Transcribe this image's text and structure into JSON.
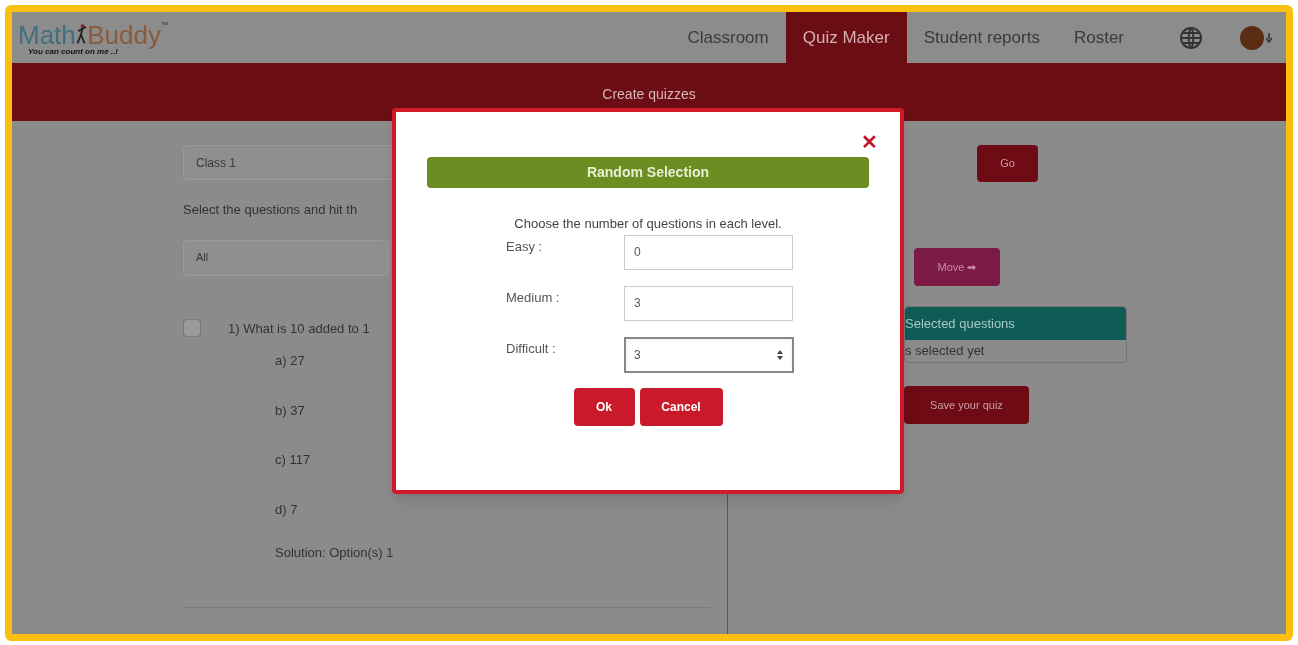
{
  "logo": {
    "word_1": "Math",
    "word_2": "Buddy",
    "trademark": "™",
    "tagline": "You can count on me ..!"
  },
  "nav": [
    {
      "label": "Classroom",
      "selected": false
    },
    {
      "label": "Quiz Maker",
      "selected": true
    },
    {
      "label": "Student reports",
      "selected": false
    },
    {
      "label": "Roster",
      "selected": false
    }
  ],
  "banner": {
    "title": "Create quizzes"
  },
  "left": {
    "class_select": {
      "value": "Class 1"
    },
    "instruction": "Select the questions and hit th",
    "filter_select": {
      "value": "All"
    },
    "question": {
      "checked": false,
      "text": "1) What is 10 added to 1",
      "options": [
        "a) 27",
        "b) 37",
        "c) 117",
        "d) 7"
      ],
      "solution": "Solution: Option(s) 1"
    }
  },
  "right": {
    "go_button": "Go",
    "move_button": "Move ➡",
    "selected_panel": {
      "title": "Selected questions",
      "empty_text": "s selected yet"
    },
    "save_button": "Save your quiz"
  },
  "dialog": {
    "close": "✕",
    "title": "Random Selection",
    "instruction": "Choose the number of questions in each level.",
    "fields": [
      {
        "label": "Easy :",
        "value": "0",
        "focused": false
      },
      {
        "label": "Medium :",
        "value": "3",
        "focused": false
      },
      {
        "label": "Difficult :",
        "value": "3",
        "focused": true
      }
    ],
    "buttons": [
      "Ok",
      "Cancel"
    ]
  }
}
